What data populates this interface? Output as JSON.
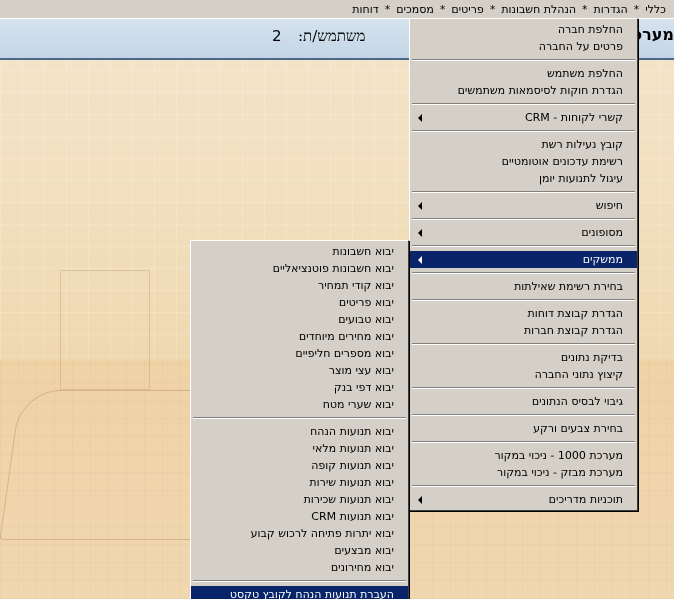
{
  "menubar": {
    "items": [
      "כללי",
      "הגדרות",
      "הנהלת חשבונות",
      "פריטים",
      "מסמכים",
      "דוחות"
    ],
    "separator": "*"
  },
  "header": {
    "title_fragment": "מערכ",
    "user_label": "משתמש/ת:",
    "user_value": "2"
  },
  "main_menu": {
    "groups": [
      [
        {
          "label": "החלפת חברה"
        },
        {
          "label": "פרטים על החברה"
        }
      ],
      [
        {
          "label": "החלפת משתמש"
        },
        {
          "label": "הגדרת חוקות לסיסמאות משתמשים"
        }
      ],
      [
        {
          "label": "קשרי לקוחות - CRM",
          "submenu": true
        }
      ],
      [
        {
          "label": "קובץ נעילות רשת"
        },
        {
          "label": "רשימת עדכונים אוטומטיים"
        },
        {
          "label": "עיגול לתנועות יומן"
        }
      ],
      [
        {
          "label": "חיפוש",
          "submenu": true
        }
      ],
      [
        {
          "label": "מסופונים",
          "submenu": true
        }
      ],
      [
        {
          "label": "ממשקים",
          "submenu": true,
          "active": true
        }
      ],
      [
        {
          "label": "בחירת רשימת שאילתות"
        }
      ],
      [
        {
          "label": "הגדרת קבוצת דוחות"
        },
        {
          "label": "הגדרת קבוצת חברות"
        }
      ],
      [
        {
          "label": "בדיקת נתונים"
        },
        {
          "label": "קיצוץ נתוני החברה"
        }
      ],
      [
        {
          "label": "גיבוי לבסיס הנתונים"
        }
      ],
      [
        {
          "label": "בחירת צבעים ורקע"
        }
      ],
      [
        {
          "label": "מערכת 1000 - ניכוי במקור"
        },
        {
          "label": "מערכת מבזק - ניכוי במקור"
        }
      ],
      [
        {
          "label": "תוכניות מדריכים",
          "submenu": true
        }
      ]
    ]
  },
  "sub_menu": {
    "groups": [
      [
        {
          "label": "יבוא חשבונות"
        },
        {
          "label": "יבוא חשבונות פוטנציאליים"
        },
        {
          "label": "יבוא קודי תמחיר"
        },
        {
          "label": "יבוא פריטים"
        },
        {
          "label": "יבוא טבועים"
        },
        {
          "label": "יבוא מחירים מיוחדים"
        },
        {
          "label": "יבוא מספרים חליפיים"
        },
        {
          "label": "יבוא עצי מוצר"
        },
        {
          "label": "יבוא דפי בנק"
        },
        {
          "label": "יבוא שערי מטח"
        }
      ],
      [
        {
          "label": "יבוא תנועות הנהח"
        },
        {
          "label": "יבוא תנועות מלאי"
        },
        {
          "label": "יבוא תנועות קופה"
        },
        {
          "label": "יבוא תנועות שירות"
        },
        {
          "label": "יבוא תנועות שכירות"
        },
        {
          "label": "יבוא תנועות CRM"
        },
        {
          "label": "יבוא יתרות פתיחה לרכוש קבוע"
        },
        {
          "label": "יבוא מבצעים"
        },
        {
          "label": "יבוא מחירונים"
        }
      ],
      [
        {
          "label": "העברת תנועות הנהח לקובץ טקסט",
          "active": true
        }
      ]
    ]
  }
}
